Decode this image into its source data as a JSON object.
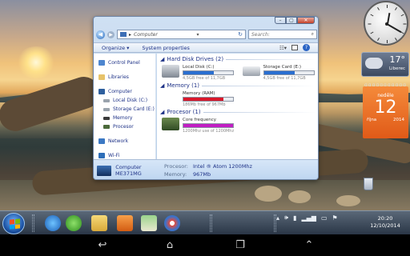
{
  "window": {
    "address_text": "Computer",
    "search_placeholder": "Search:",
    "toolbar": {
      "organize": "Organize ▾",
      "system_properties": "System properties"
    },
    "buttons": {
      "minimize": "–",
      "maximize": "▢",
      "close": "✕"
    }
  },
  "nav_pane": {
    "control_panel": "Control Panel",
    "libraries": "Libraries",
    "computer": "Computer",
    "local_disk": "Local Disk (C:)",
    "storage_card": "Storage Card (E:)",
    "memory": "Memory",
    "procesor": "Procesor",
    "network": "Network",
    "wifi": "Wi-Fi"
  },
  "content": {
    "hard_disk_drives": {
      "header": "Hard Disk Drives (2)",
      "items": [
        {
          "name": "Local Disk (C:)",
          "free": "4,5GB free of 11,7GB",
          "usage": 0.62
        },
        {
          "name": "Storage Card (E:)",
          "free": "4,5GB free of 11,7GB",
          "usage": 0.62
        }
      ]
    },
    "memory": {
      "header": "Memory (1)",
      "item": {
        "name": "Memory (RAM)",
        "free": "186Mb free of 967Mb",
        "usage": 0.81
      }
    },
    "processor": {
      "header": "Procesor (1)",
      "item": {
        "name": "Core frequency",
        "free": "1200Mhz use of 1200Mhz",
        "usage": 1.0
      }
    }
  },
  "details": {
    "computer_name": "Computer",
    "model": "ME371MG",
    "processor_label": "Procesor:",
    "processor_value": "Intel ® Atom 1200Mhz",
    "memory_label": "Memory:",
    "memory_value": "967Mb"
  },
  "gadgets": {
    "weather_temp": "17°",
    "weather_city": "Liberec",
    "calendar_dow": "neděle",
    "calendar_day": "12",
    "calendar_month": "října",
    "calendar_year": "2014"
  },
  "taskbar": {
    "time": "20:20",
    "date": "12/10/2014"
  },
  "colors": {
    "disk_bar": "#2a6fd0",
    "memory_bar": "#d8182b",
    "cpu_bar": "#c21ec3",
    "calendar": "#e8641e"
  }
}
